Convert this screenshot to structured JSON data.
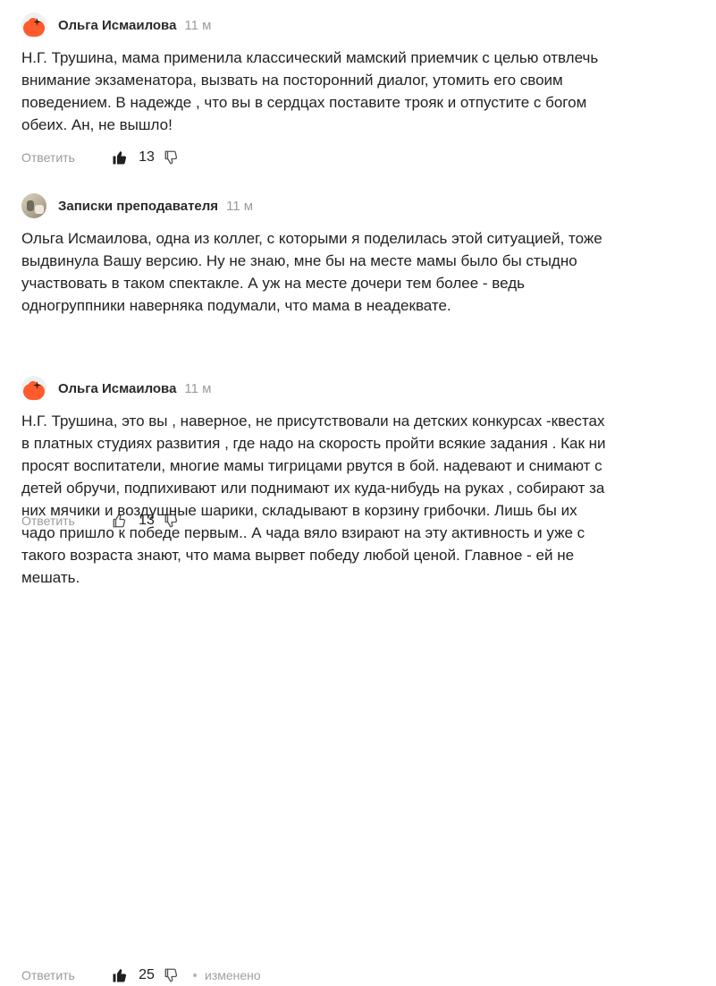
{
  "comments": [
    {
      "author": "Ольга Исмаилова",
      "time": "11 м",
      "avatar": "orange-blob-logo",
      "text_lines": [
        "Н.Г. Трушина, мама применила классический мамский приемчик с целью отвлечь",
        "внимание экзаменатора, вызвать на посторонний диалог, утомить его своим",
        "поведением. В надежде , что вы в сердцах поставите трояк и отпустите с богом",
        "обеих. Ан, не вышло!"
      ],
      "reply_label": "Ответить",
      "likes": "13",
      "like_state": "filled"
    },
    {
      "author": "Записки преподавателя",
      "time": "11 м",
      "avatar": "photo",
      "text_lines": [
        "Ольга Исмаилова, одна из коллег, с которыми я поделилась этой ситуацией, тоже",
        "выдвинула Вашу версию. Ну не знаю, мне бы на месте мамы было бы стыдно",
        "участвовать в таком спектакле. А уж на месте дочери тем более - ведь",
        "одногруппники наверняка подумали, что мама в неадеквате."
      ],
      "reply_label": "Ответить",
      "likes": "13",
      "like_state": "outline"
    },
    {
      "author": "Ольга Исмаилова",
      "time": "11 м",
      "avatar": "orange-blob-logo",
      "text_lines": [
        "Н.Г. Трушина, это вы , наверное, не присутствовали на детских конкурсах -квестах",
        "в платных студиях развития , где надо на скорость пройти всякие задания . Как ни",
        "просят воспитатели, многие мамы тигрицами рвутся в бой. надевают и снимают с",
        "детей обручи, подпихивают или поднимают их куда-нибудь на руках , собирают за",
        "них мячики и воздушные шарики, складывают в корзину грибочки. Лишь бы их",
        "чадо пришло к победе первым.. А чада вяло взирают на эту активность и уже с",
        "такого возраста знают, что мама вырвет победу любой ценой. Главное - ей не",
        "мешать."
      ],
      "reply_label": "Ответить",
      "likes": "25",
      "like_state": "filled",
      "edited_label": "изменено"
    }
  ],
  "colors": {
    "accent_logo": "#ff5b2c",
    "muted_text": "#9a9a9a",
    "body_text": "#222222"
  }
}
